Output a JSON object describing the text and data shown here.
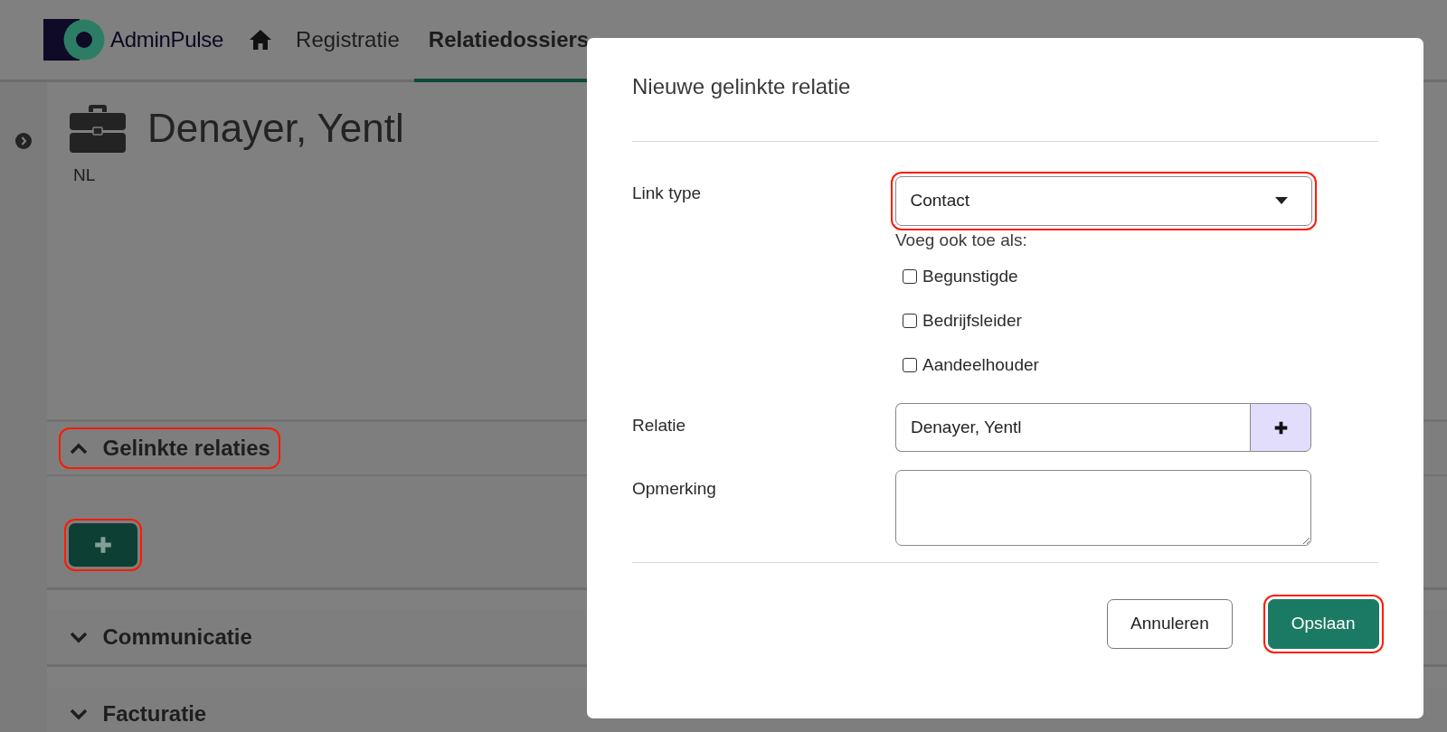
{
  "nav": {
    "logo": "AdminPulse",
    "items": [
      {
        "label": "Registratie",
        "selected": false
      },
      {
        "label": "Relatiedossiers",
        "selected": true
      }
    ]
  },
  "relation": {
    "name": "Denayer, Yentl",
    "language": "NL"
  },
  "sections": [
    {
      "title": "Gelinkte relaties",
      "expanded": true,
      "highlighted": true,
      "add_button": {
        "highlighted": true
      }
    },
    {
      "title": "Communicatie",
      "expanded": false,
      "highlighted": false
    },
    {
      "title": "Facturatie",
      "expanded": false,
      "highlighted": false
    }
  ],
  "dialog": {
    "title": "Nieuwe gelinkte relatie",
    "link_type": {
      "label": "Link type",
      "value": "Contact",
      "highlighted": true
    },
    "also_add": {
      "label": "Voeg ook toe als:",
      "options": [
        {
          "label": "Begunstigde",
          "checked": false
        },
        {
          "label": "Bedrijfsleider",
          "checked": false
        },
        {
          "label": "Aandeelhouder",
          "checked": false
        }
      ]
    },
    "relation": {
      "label": "Relatie",
      "value": "Denayer, Yentl"
    },
    "remark": {
      "label": "Opmerking"
    },
    "buttons": [
      {
        "label": "Annuleren",
        "kind": "secondary",
        "highlighted": false
      },
      {
        "label": "Opslaan",
        "kind": "primary",
        "highlighted": true
      }
    ]
  }
}
